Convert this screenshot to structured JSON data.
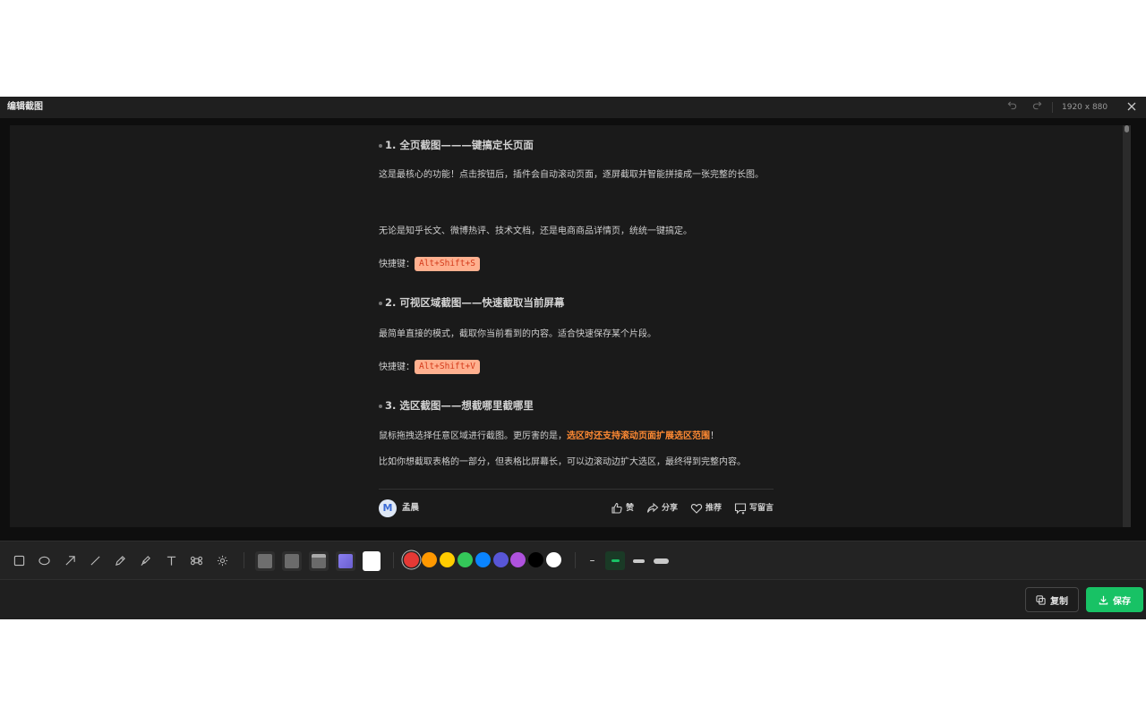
{
  "window": {
    "title": "编辑截图",
    "dimensions": "1920 x 880",
    "undo_icon": "undo-icon",
    "redo_icon": "redo-icon",
    "close_icon": "close-icon"
  },
  "article": {
    "sections": [
      {
        "heading": "1. 全页截图———键搞定长页面",
        "paragraphs": [
          "这是最核心的功能！点击按钮后，插件会自动滚动页面，逐屏截取并智能拼接成一张完整的长图。",
          "无论是知乎长文、微博热评、技术文档，还是电商商品详情页，统统一键搞定。"
        ],
        "shortcut_label": "快捷键：",
        "shortcut": "Alt+Shift+S"
      },
      {
        "heading": "2. 可视区域截图——快速截取当前屏幕",
        "paragraphs": [
          "最简单直接的模式，截取你当前看到的内容。适合快速保存某个片段。"
        ],
        "shortcut_label": "快捷键：",
        "shortcut": "Alt+Shift+V"
      },
      {
        "heading": "3. 选区截图——想截哪里截哪里",
        "paragraph_prefix": "鼠标拖拽选择任意区域进行截图。更厉害的是，",
        "paragraph_highlight": "选区时还支持滚动页面扩展选区范围",
        "paragraph_suffix": "！",
        "paragraph_2": "比如你想截取表格的一部分，但表格比屏幕长，可以边滚动边扩大选区，最终得到完整内容。"
      }
    ],
    "author": {
      "avatar_letter": "M",
      "name": "孟晨"
    },
    "actions": [
      {
        "icon": "thumbs-up-icon",
        "label": "赞"
      },
      {
        "icon": "share-icon",
        "label": "分享"
      },
      {
        "icon": "heart-icon",
        "label": "推荐"
      },
      {
        "icon": "comment-icon",
        "label": "写留言"
      }
    ]
  },
  "toolbar": {
    "tools": [
      "rectangle-icon",
      "ellipse-icon",
      "arrow-icon",
      "line-icon",
      "pen-icon",
      "highlighter-icon",
      "text-icon",
      "mosaic-icon",
      "blur-icon"
    ],
    "backgrounds": [
      "#6e6e6e",
      "#6b6b6b",
      "#8a8a8a",
      "#7b6fe0",
      "#ffffff"
    ],
    "colors": [
      "#e53935",
      "#ff9800",
      "#ffcc00",
      "#34c759",
      "#0a84ff",
      "#5856d6",
      "#af52de",
      "#000000",
      "#ffffff"
    ],
    "selected_color": "#e53935",
    "stroke_widths": [
      "small",
      "medium",
      "large",
      "x-large"
    ],
    "selected_stroke": "medium",
    "accent": "#18c265"
  },
  "buttons": {
    "copy_label": "复制",
    "save_label": "保存"
  }
}
